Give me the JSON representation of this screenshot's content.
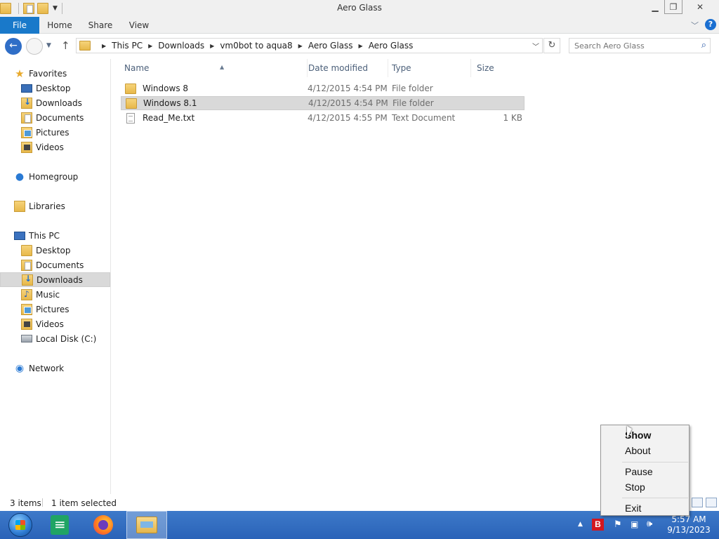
{
  "window": {
    "title": "Aero Glass",
    "min_icon": "minimize-icon",
    "max_icon": "restore-icon",
    "close_icon": "close-icon"
  },
  "ribbon": {
    "file": "File",
    "home": "Home",
    "share": "Share",
    "view": "View"
  },
  "address": {
    "crumbs": [
      "This PC",
      "Downloads",
      "vm0bot to aqua8",
      "Aero Glass",
      "Aero Glass"
    ]
  },
  "search": {
    "placeholder": "Search Aero Glass"
  },
  "nav": {
    "favorites": "Favorites",
    "fav_items": [
      "Desktop",
      "Downloads",
      "Documents",
      "Pictures",
      "Videos"
    ],
    "homegroup": "Homegroup",
    "libraries": "Libraries",
    "this_pc": "This PC",
    "pc_items": [
      "Desktop",
      "Documents",
      "Downloads",
      "Music",
      "Pictures",
      "Videos",
      "Local Disk (C:)"
    ],
    "network": "Network",
    "selected": "Downloads"
  },
  "list": {
    "columns": {
      "name": "Name",
      "date": "Date modified",
      "type": "Type",
      "size": "Size"
    },
    "rows": [
      {
        "name": "Windows 8",
        "date": "4/12/2015 4:54 PM",
        "type": "File folder",
        "size": ""
      },
      {
        "name": "Windows 8.1",
        "date": "4/12/2015 4:54 PM",
        "type": "File folder",
        "size": ""
      },
      {
        "name": "Read_Me.txt",
        "date": "4/12/2015 4:55 PM",
        "type": "Text Document",
        "size": "1 KB"
      }
    ]
  },
  "status": {
    "count": "3 items",
    "selection": "1 item selected"
  },
  "context_menu": {
    "items": [
      "Show",
      "About",
      "Pause",
      "Stop",
      "Exit"
    ]
  },
  "taskbar": {
    "time": "5:57 AM",
    "date": "9/13/2023",
    "tray_b": "B"
  },
  "colors": {
    "file_tab": "#1979ca",
    "taskbar": "#2a63b8",
    "selection": "#d9d9d9"
  }
}
